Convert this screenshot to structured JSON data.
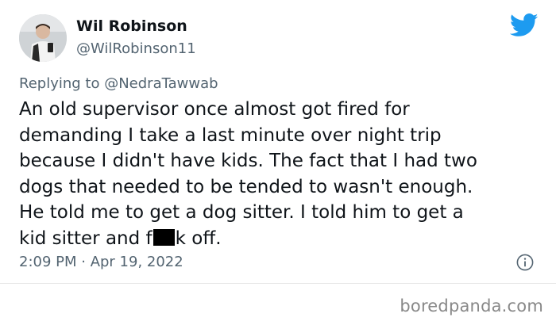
{
  "author": {
    "display_name": "Wil Robinson",
    "handle": "@WilRobinson11",
    "avatar_icon": "profile-photo-icon"
  },
  "brand": {
    "icon": "twitter-bird-icon",
    "color": "#1d9bf0"
  },
  "reply": {
    "prefix": "Replying to",
    "target": "@NedraTawwab"
  },
  "tweet": {
    "lines": [
      "An old supervisor once almost got fired for",
      "demanding I take a last minute over night trip",
      "because I didn't have kids. The fact that I had two",
      "dogs that needed to be tended to wasn't enough.",
      "He told me to get a dog sitter. I told him to get a"
    ],
    "last_line_before": "kid sitter and f",
    "last_line_after": "k off."
  },
  "meta": {
    "timestamp": "2:09 PM · Apr 19, 2022",
    "info_icon": "info-icon"
  },
  "watermark": "boredpanda.com"
}
